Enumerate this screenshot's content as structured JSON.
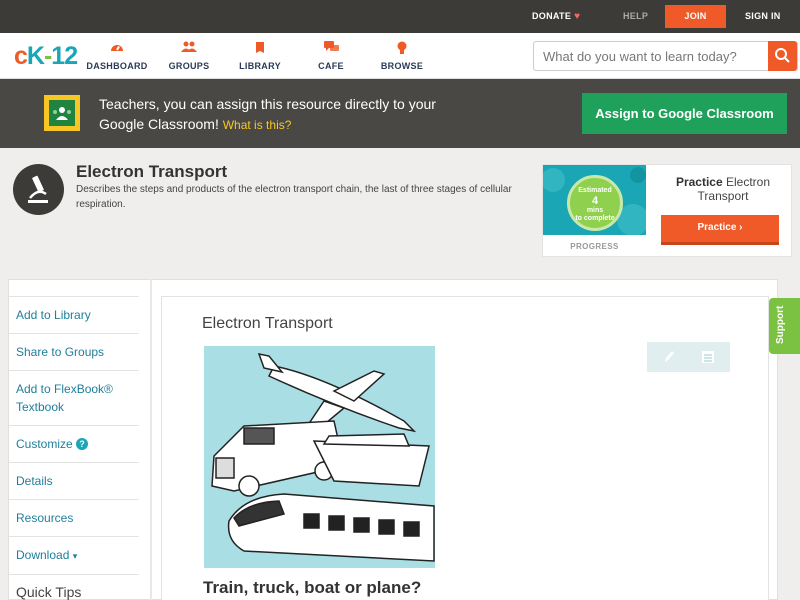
{
  "topbar": {
    "donate": "DONATE",
    "help": "HELP",
    "join": "JOIN",
    "signin": "SIGN IN"
  },
  "nav": {
    "logo": {
      "c": "c",
      "k": "K",
      "dash": "-",
      "num": "12"
    },
    "items": [
      {
        "label": "DASHBOARD",
        "icon": "dashboard-icon"
      },
      {
        "label": "GROUPS",
        "icon": "groups-icon"
      },
      {
        "label": "LIBRARY",
        "icon": "library-icon"
      },
      {
        "label": "CAFE",
        "icon": "cafe-icon"
      },
      {
        "label": "BROWSE",
        "icon": "browse-icon"
      }
    ],
    "search_placeholder": "What do you want to learn today?"
  },
  "banner": {
    "text": "Teachers, you can assign this resource directly to your Google Classroom!",
    "link": "What is this?",
    "button": "Assign to Google Classroom"
  },
  "article": {
    "title": "Electron Transport",
    "description": "Describes the steps and products of the electron transport chain, the last of three stages of cellular respiration."
  },
  "practice": {
    "estimated_line1": "Estimated",
    "estimated_value": "4",
    "estimated_line2": "mins",
    "estimated_line3": "to complete",
    "progress_label": "PROGRESS",
    "name_bold": "Practice",
    "name_rest": "Electron Transport",
    "button": "Practice"
  },
  "sidebar": {
    "items": [
      "Add to Library",
      "Share to Groups",
      "Add to FlexBook® Textbook",
      "Customize",
      "Details",
      "Resources",
      "Download"
    ],
    "customize_badge": "?",
    "download_caret": "▾",
    "quick_tips": "Quick Tips"
  },
  "content": {
    "title": "Electron Transport",
    "heading": "Train, truck, boat or plane?"
  },
  "support": "Support",
  "colors": {
    "accent_orange": "#f05a28",
    "brand_teal": "#1aa6b4",
    "google_green": "#20a15b",
    "support_green": "#7cc242"
  }
}
